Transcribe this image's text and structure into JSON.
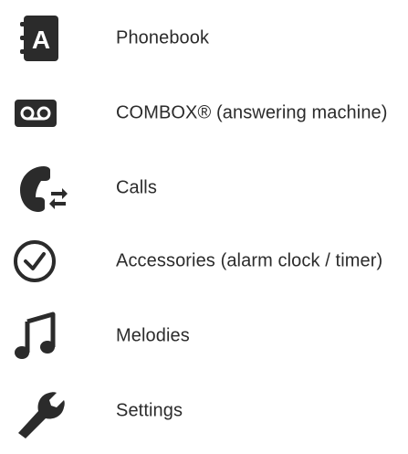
{
  "menu": {
    "items": [
      {
        "label": "Phonebook",
        "icon": "phonebook-icon"
      },
      {
        "label": "COMBOX® (answering machine)",
        "icon": "voicemail-icon"
      },
      {
        "label": "Calls",
        "icon": "calls-icon"
      },
      {
        "label": "Accessories (alarm clock / timer)",
        "icon": "clock-icon"
      },
      {
        "label": "Melodies",
        "icon": "music-note-icon"
      },
      {
        "label": "Settings",
        "icon": "wrench-icon"
      }
    ]
  },
  "colors": {
    "icon": "#2b2b2b",
    "text": "#2b2b2b",
    "background": "#ffffff"
  }
}
